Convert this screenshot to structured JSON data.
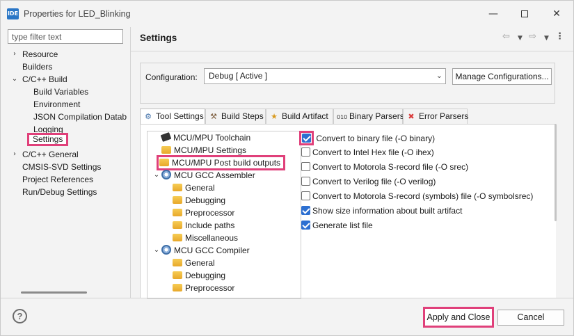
{
  "window": {
    "app_icon_text": "IDE",
    "title": "Properties for LED_Blinking"
  },
  "filter": {
    "placeholder": "type filter text"
  },
  "nav": {
    "items": [
      {
        "label": "Resource",
        "expandable": true
      },
      {
        "label": "Builders"
      },
      {
        "label": "C/C++ Build",
        "expanded": true
      },
      {
        "label": "Build Variables"
      },
      {
        "label": "Environment"
      },
      {
        "label": "JSON Compilation Datab"
      },
      {
        "label": "Logging"
      },
      {
        "label": "Settings",
        "selected": true
      },
      {
        "label": "C/C++ General",
        "expandable": true
      },
      {
        "label": "CMSIS-SVD Settings"
      },
      {
        "label": "Project References"
      },
      {
        "label": "Run/Debug Settings"
      }
    ]
  },
  "header": {
    "title": "Settings"
  },
  "configuration": {
    "label": "Configuration:",
    "value": "Debug  [ Active ]",
    "manage_label": "Manage Configurations..."
  },
  "tabs": [
    {
      "label": "Tool Settings",
      "icon": "gear-icon",
      "active": true
    },
    {
      "label": "Build Steps",
      "icon": "hammer-icon"
    },
    {
      "label": "Build Artifact",
      "icon": "trophy-icon"
    },
    {
      "label": "Binary Parsers",
      "icon": "binary-icon"
    },
    {
      "label": "Error Parsers",
      "icon": "error-icon"
    }
  ],
  "tool_tree": [
    {
      "label": "MCU/MPU Toolchain",
      "icon": "chip-icon"
    },
    {
      "label": "MCU/MPU Settings",
      "icon": "folder-icon"
    },
    {
      "label": "MCU/MPU Post build outputs",
      "icon": "folder-icon",
      "highlighted": true
    },
    {
      "label": "MCU GCC Assembler",
      "icon": "gear-icon",
      "expanded": true
    },
    {
      "label": "General",
      "icon": "folder-icon"
    },
    {
      "label": "Debugging",
      "icon": "folder-icon"
    },
    {
      "label": "Preprocessor",
      "icon": "folder-icon"
    },
    {
      "label": "Include paths",
      "icon": "folder-icon"
    },
    {
      "label": "Miscellaneous",
      "icon": "folder-icon"
    },
    {
      "label": "MCU GCC Compiler",
      "icon": "gear-icon",
      "expanded": true
    },
    {
      "label": "General",
      "icon": "folder-icon"
    },
    {
      "label": "Debugging",
      "icon": "folder-icon"
    },
    {
      "label": "Preprocessor",
      "icon": "folder-icon"
    }
  ],
  "options": [
    {
      "label": "Convert to binary file (-O binary)",
      "checked": true,
      "highlighted": true
    },
    {
      "label": "Convert to Intel Hex file (-O ihex)",
      "checked": false
    },
    {
      "label": "Convert to Motorola S-record file (-O srec)",
      "checked": false
    },
    {
      "label": "Convert to Verilog file (-O verilog)",
      "checked": false
    },
    {
      "label": "Convert to Motorola S-record (symbols) file (-O symbolsrec)",
      "checked": false
    },
    {
      "label": "Show size information about built artifact",
      "checked": true
    },
    {
      "label": "Generate list file",
      "checked": true
    }
  ],
  "footer": {
    "help_symbol": "?",
    "apply_label": "Apply and Close",
    "cancel_label": "Cancel"
  },
  "colors": {
    "highlight": "#e0407a",
    "checkbox": "#2c6fd1"
  }
}
